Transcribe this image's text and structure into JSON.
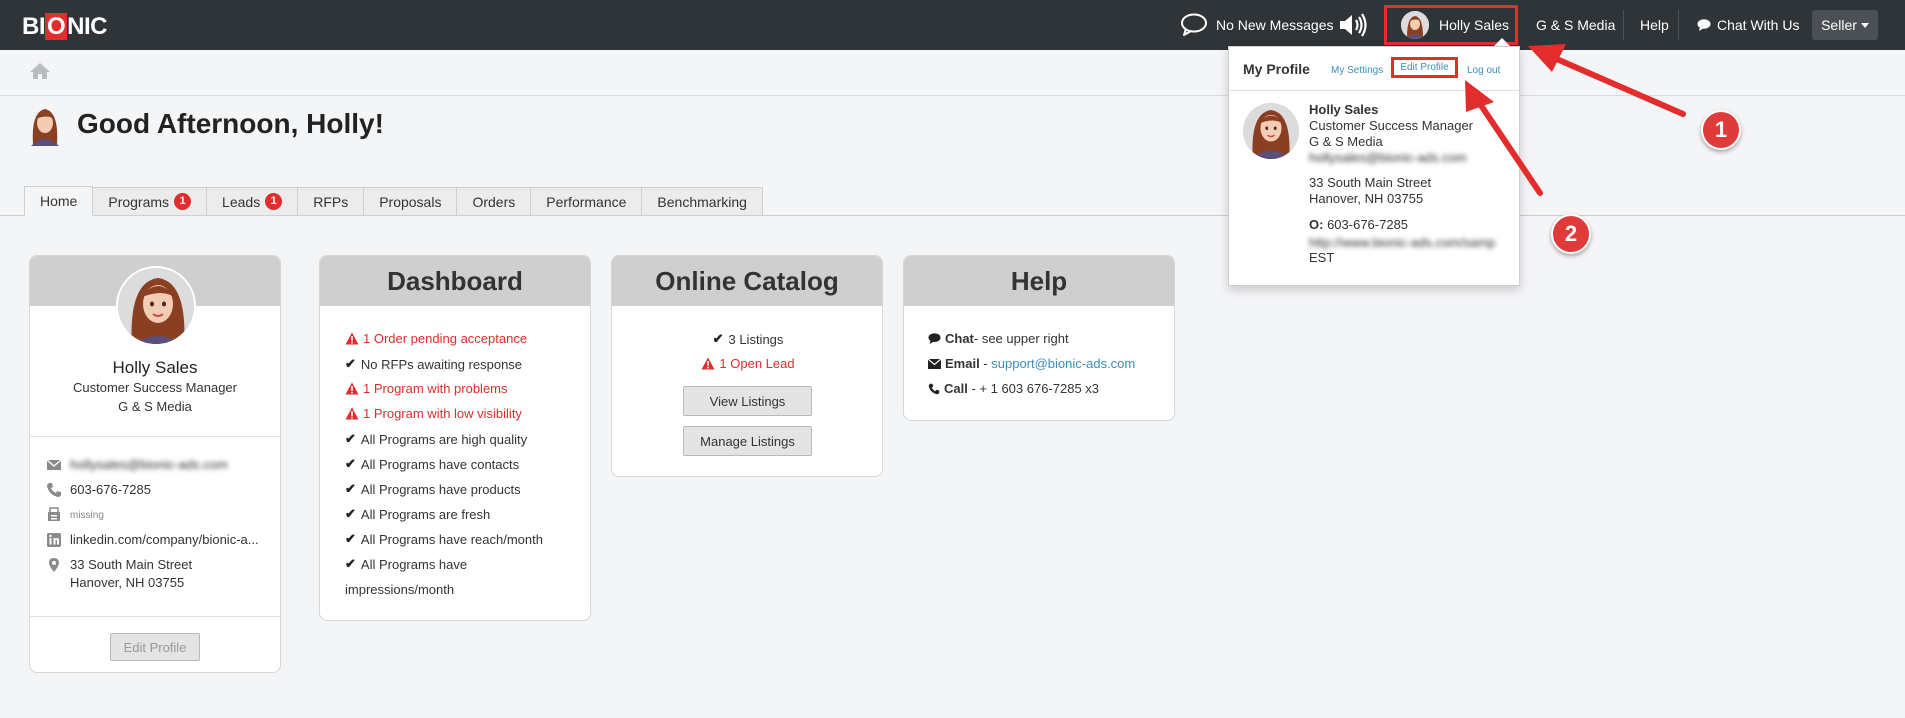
{
  "header": {
    "logo_text_left": "BI",
    "logo_text_o": "O",
    "logo_text_right": "NIC",
    "messages": "No New Messages",
    "user_name": "Holly Sales",
    "company": "G & S Media",
    "help": "Help",
    "chat": "Chat With Us",
    "role_menu": "Seller"
  },
  "greeting": "Good Afternoon, Holly!",
  "tabs": [
    {
      "label": "Home",
      "badge": ""
    },
    {
      "label": "Programs",
      "badge": "1"
    },
    {
      "label": "Leads",
      "badge": "1"
    },
    {
      "label": "RFPs",
      "badge": ""
    },
    {
      "label": "Proposals",
      "badge": ""
    },
    {
      "label": "Orders",
      "badge": ""
    },
    {
      "label": "Performance",
      "badge": ""
    },
    {
      "label": "Benchmarking",
      "badge": ""
    }
  ],
  "profile_card": {
    "name": "Holly Sales",
    "title": "Customer Success Manager",
    "company": "G & S Media",
    "email": "hollysales@bionic-ads.com",
    "phone": "603-676-7285",
    "fax": "missing",
    "linkedin": "linkedin.com/company/bionic-a...",
    "address_line1": "33 South Main Street",
    "address_line2": "Hanover, NH 03755",
    "edit_button": "Edit Profile"
  },
  "dashboard": {
    "title": "Dashboard",
    "items": [
      {
        "text": "1 Order pending acceptance",
        "status": "warn"
      },
      {
        "text": "No RFPs awaiting response",
        "status": "ok"
      },
      {
        "text": "1 Program with problems",
        "status": "warn"
      },
      {
        "text": "1 Program with low visibility",
        "status": "warn"
      },
      {
        "text": "All Programs are high quality",
        "status": "ok"
      },
      {
        "text": "All Programs have contacts",
        "status": "ok"
      },
      {
        "text": "All Programs have products",
        "status": "ok"
      },
      {
        "text": "All Programs are fresh",
        "status": "ok"
      },
      {
        "text": "All Programs have reach/month",
        "status": "ok"
      },
      {
        "text": "All Programs have",
        "status": "ok"
      }
    ],
    "wrap_text": "impressions/month"
  },
  "catalog": {
    "title": "Online Catalog",
    "listings": "3 Listings",
    "open_lead": "1 Open Lead",
    "view_button": "View Listings",
    "manage_button": "Manage Listings"
  },
  "help": {
    "title": "Help",
    "chat_label": "Chat",
    "chat_text": " - see upper right",
    "email_label": "Email",
    "email_sep": " - ",
    "email_value": "support@bionic-ads.com",
    "call_label": "Call",
    "call_text": " - + 1 603 676-7285 x3"
  },
  "profile_dropdown": {
    "title": "My Profile",
    "settings_link": "My Settings",
    "edit_link": "Edit Profile",
    "logout_link": "Log out",
    "name": "Holly Sales",
    "title_text": "Customer Success Manager",
    "company": "G & S Media",
    "email": "hollysales@bionic-ads.com",
    "address_line1": "33 South Main Street",
    "address_line2": "Hanover, NH 03755",
    "office_label": "O:",
    "office_phone": "603-676-7285",
    "website": "http://www.bionic-ads.com/samp",
    "timezone": "EST"
  },
  "callouts": {
    "step1": "1",
    "step2": "2"
  },
  "colors": {
    "topbar": "#2f3438",
    "accent_red": "#e02d2d",
    "link_blue": "#3c8dbc",
    "card_header": "#cfcfcf"
  }
}
